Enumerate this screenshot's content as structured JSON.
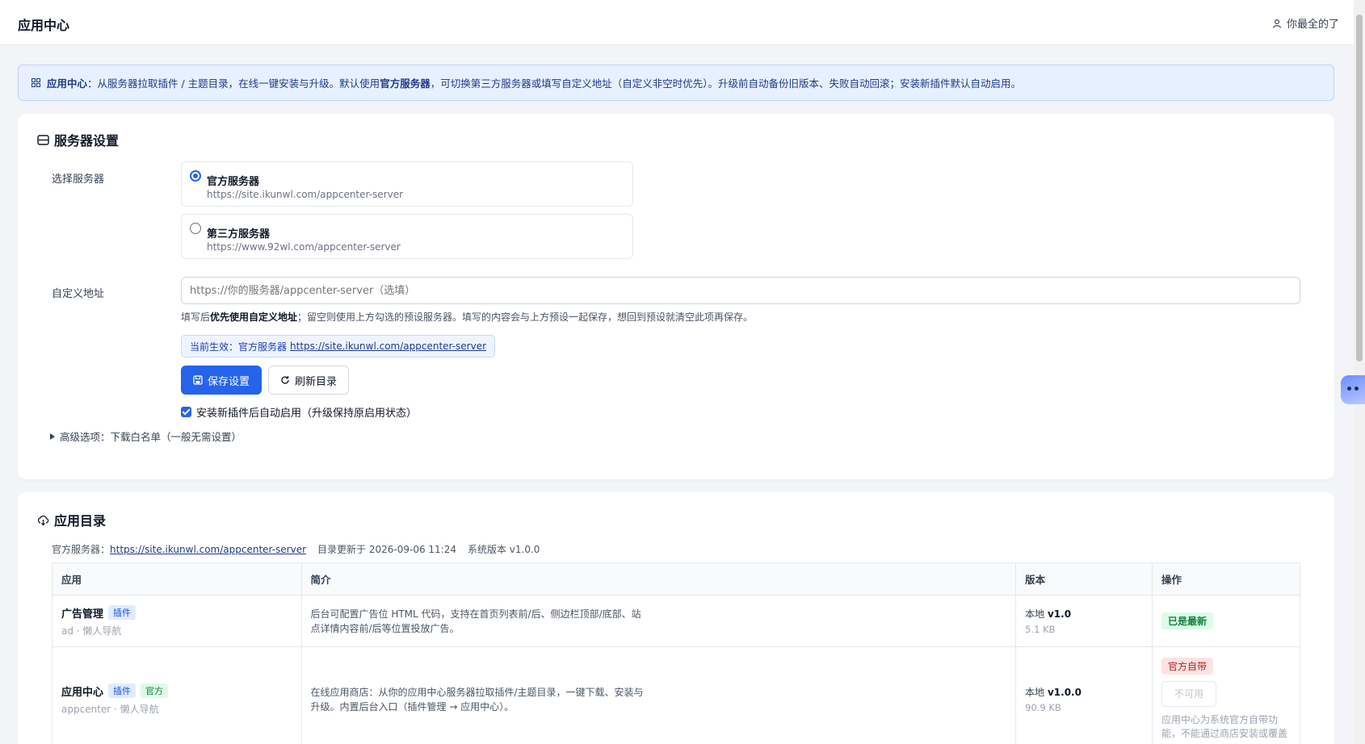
{
  "header": {
    "title": "应用中心",
    "user_label": "你最全的了"
  },
  "notice": {
    "lead": "应用中心",
    "text1": "：从服务器拉取插件 / 主题目录，在线一键安装与升级。默认使用",
    "strong": "官方服务器",
    "text2": "，可切换第三方服务器或填写自定义地址（自定义非空时优先）。升级前自动备份旧版本、失败自动回滚；安装新插件默认自动启用。"
  },
  "server_settings": {
    "title": "服务器设置",
    "select_label": "选择服务器",
    "options": [
      {
        "name": "官方服务器",
        "url": "https://site.ikunwl.com/appcenter-server",
        "selected": true
      },
      {
        "name": "第三方服务器",
        "url": "https://www.92wl.com/appcenter-server",
        "selected": false
      }
    ],
    "custom_label": "自定义地址",
    "custom_placeholder": "https://你的服务器/appcenter-server（选填）",
    "hint_pre": "填写后",
    "hint_strong": "优先使用自定义地址",
    "hint_post": "；留空则使用上方勾选的预设服务器。填写的内容会与上方预设一起保存，想回到预设就清空此项再保存。",
    "effective_label": "当前生效：官方服务器",
    "effective_url": "https://site.ikunwl.com/appcenter-server",
    "save_label": "保存设置",
    "refresh_label": "刷新目录",
    "auto_enable_label": "安装新插件后自动启用（升级保持原启用状态）",
    "advanced_label": "高级选项：下载白名单（一般无需设置）"
  },
  "catalog": {
    "title": "应用目录",
    "server_label": "官方服务器：",
    "server_url": "https://site.ikunwl.com/appcenter-server",
    "updated": "目录更新于 2026-09-06 11:24",
    "system_version": "系统版本 v1.0.0",
    "columns": [
      "应用",
      "简介",
      "版本",
      "操作"
    ],
    "rows": [
      {
        "name": "广告管理",
        "tags": [
          "插件"
        ],
        "sub": "ad · 懒人导航",
        "desc": "后台可配置广告位 HTML 代码，支持在首页列表前/后、侧边栏顶部/底部、站点详情内容前/后等位置投放广告。",
        "local_label": "本地",
        "version": "v1.0",
        "size": "5.1 KB",
        "status": "已是最新"
      },
      {
        "name": "应用中心",
        "tags": [
          "插件",
          "官方"
        ],
        "sub": "appcenter · 懒人导航",
        "desc": "在线应用商店：从你的应用中心服务器拉取插件/主题目录，一键下载、安装与升级。内置后台入口（插件管理 → 应用中心）。",
        "local_label": "本地",
        "version": "v1.0.0",
        "size": "90.9 KB",
        "status": "官方自带",
        "button": "不可用",
        "note": "应用中心为系统官方自带功能，不能通过商店安装或覆盖"
      }
    ]
  },
  "colors": {
    "accent": "#2563eb",
    "notice_bg": "#e7f0ff",
    "success": "#15803d",
    "danger": "#b91c1c"
  }
}
